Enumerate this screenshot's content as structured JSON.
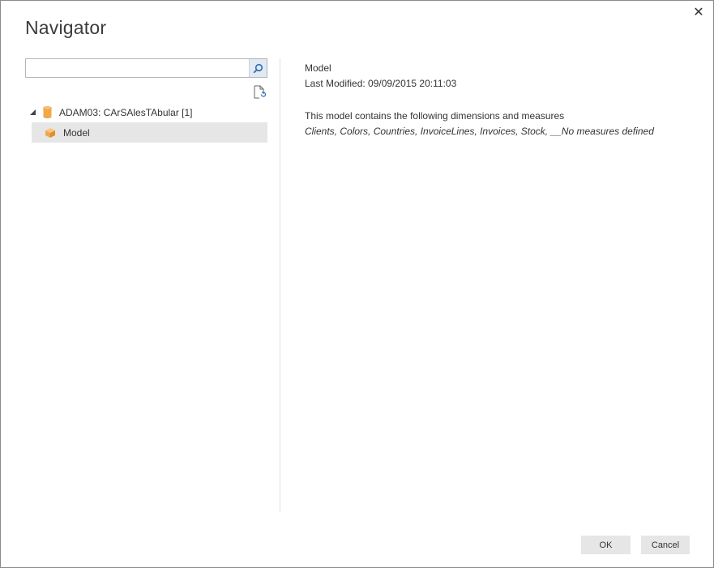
{
  "window": {
    "title": "Navigator",
    "close_icon": "close-icon"
  },
  "search": {
    "value": "",
    "placeholder": "",
    "icon": "search-icon"
  },
  "toolbar": {
    "refresh_icon": "refresh-document-icon"
  },
  "tree": {
    "root": {
      "label": "ADAM03: CArSAlesTAbular [1]",
      "icon": "database-icon",
      "expanded": true
    },
    "children": [
      {
        "label": "Model",
        "icon": "cube-icon",
        "selected": true
      }
    ]
  },
  "details": {
    "name": "Model",
    "last_modified": "Last Modified: 09/09/2015 20:11:03",
    "description": "This model contains the following dimensions and measures",
    "contents": "Clients, Colors, Countries, InvoiceLines, Invoices, Stock, __No measures defined"
  },
  "footer": {
    "ok_label": "OK",
    "cancel_label": "Cancel"
  },
  "colors": {
    "selection_bg": "#e6e6e6",
    "search_button_bg": "#e1e9f3",
    "icon_orange": "#f0a848",
    "button_bg": "#e6e6e6"
  }
}
